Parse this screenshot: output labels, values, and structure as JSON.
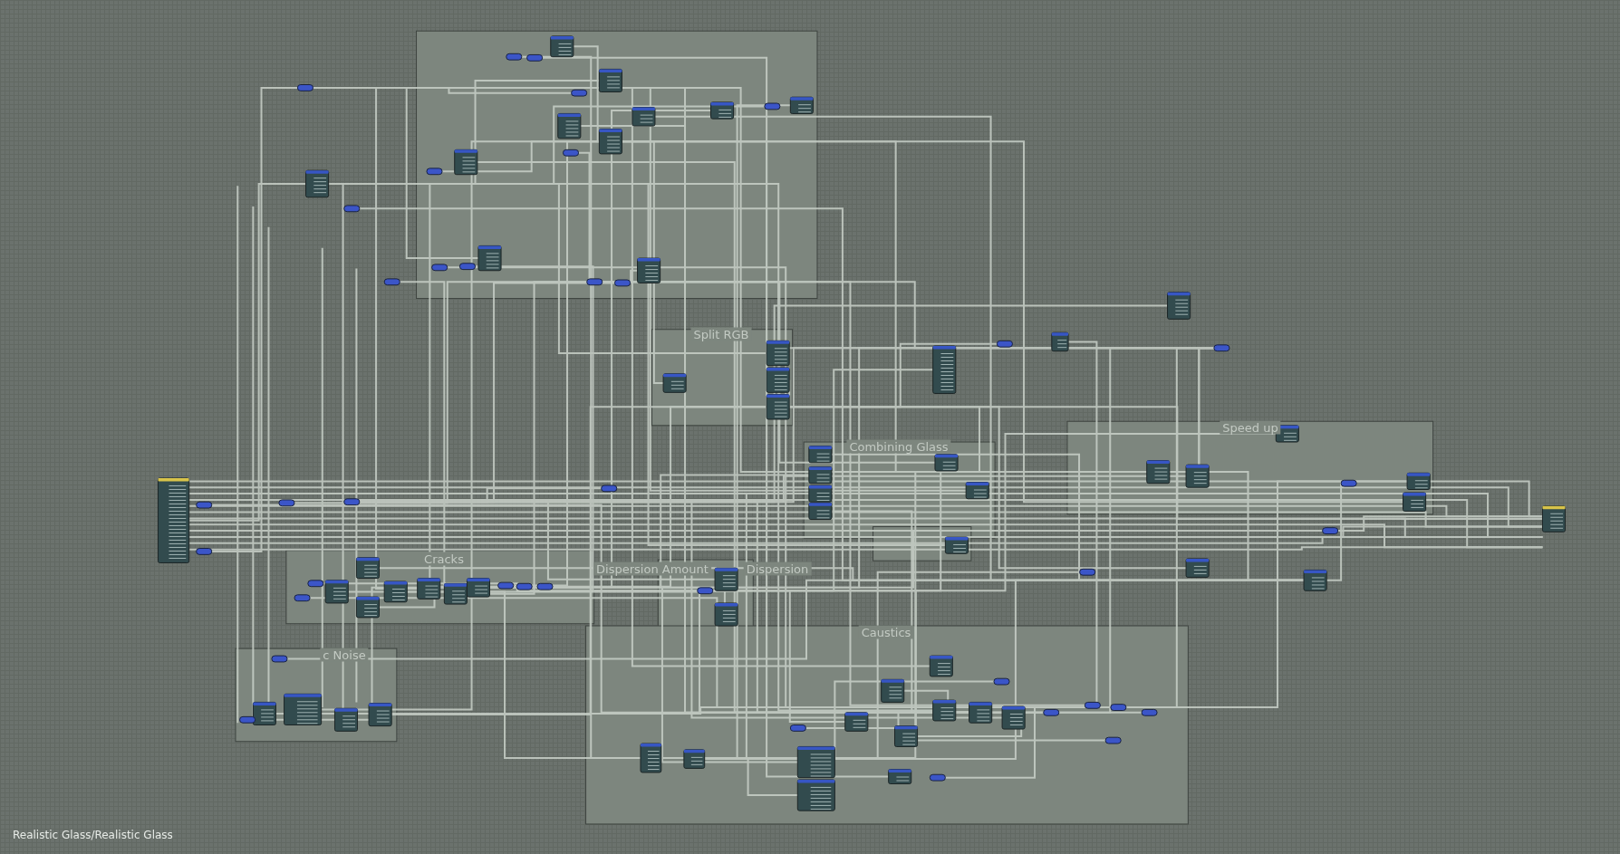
{
  "frames": [
    {
      "label": "Split RGB"
    },
    {
      "label": "Combining Glass"
    },
    {
      "label": "Speed up"
    },
    {
      "label": "Cracks"
    },
    {
      "label": "Dispersion Amount"
    },
    {
      "label": "Dispersion"
    },
    {
      "label": "Caustics"
    },
    {
      "label": "c Noise"
    }
  ],
  "breadcrumb": "Realistic Glass/Realistic Glass"
}
